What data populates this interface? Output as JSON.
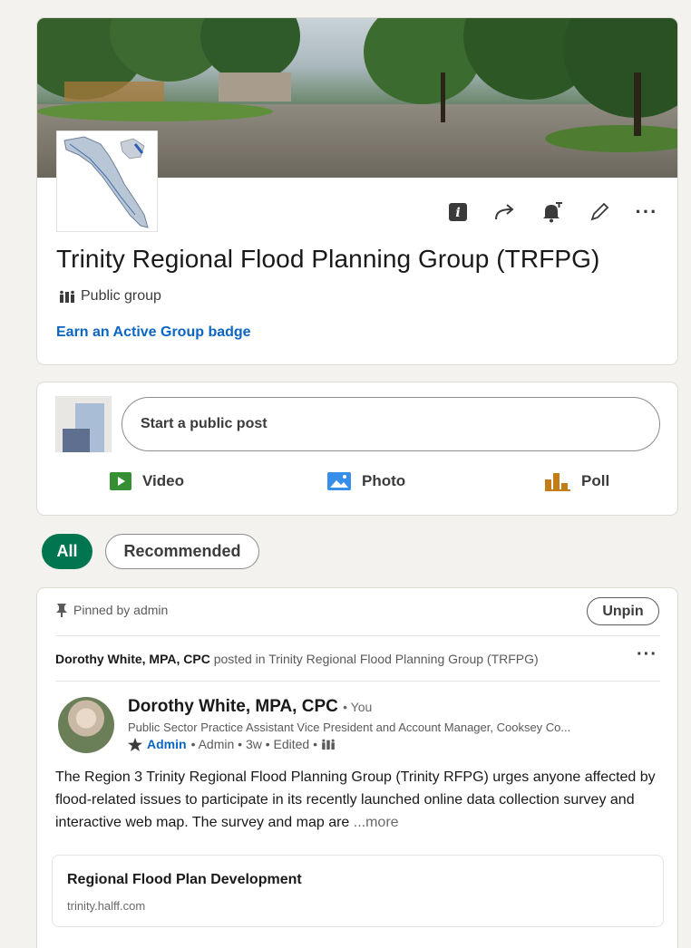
{
  "group": {
    "title": "Trinity Regional Flood Planning Group (TRFPG)",
    "type_label": "Public group",
    "badge_link": "Earn an Active Group badge",
    "actions": [
      "info-icon",
      "share-icon",
      "notification-bell-icon",
      "edit-pencil-icon",
      "more-horizontal-icon"
    ],
    "more_label": "···"
  },
  "composer": {
    "placeholder": "Start a public post",
    "media": {
      "video": "Video",
      "photo": "Photo",
      "poll": "Poll"
    },
    "colors": {
      "video": "#378f33",
      "photo": "#378fe9",
      "poll": "#c37d16"
    }
  },
  "filters": {
    "all": "All",
    "recommended": "Recommended"
  },
  "post": {
    "pinned_label": "Pinned by admin",
    "unpin_label": "Unpin",
    "posted_by": "Dorothy White, MPA, CPC",
    "posted_in_prefix": "posted in",
    "posted_in_group": "Trinity Regional Flood Planning Group (TRFPG)",
    "more_label": "···",
    "author": {
      "name": "Dorothy White, MPA, CPC",
      "you_label": "• You",
      "headline": "Public Sector Practice Assistant Vice President and Account Manager, Cooksey Co...",
      "role_strong": "Admin",
      "meta": "• Admin • 3w • Edited •"
    },
    "body": "The Region 3 Trinity Regional Flood Planning Group (Trinity RFPG) urges anyone affected by flood-related issues to participate in its recently launched online data collection survey and interactive web map. The survey and map are ",
    "more_link": "...more",
    "link_card": {
      "title": "Regional Flood Plan Development",
      "domain": "trinity.halff.com"
    }
  },
  "colors": {
    "accent": "#0a66c2",
    "pill_active": "#01754f"
  }
}
